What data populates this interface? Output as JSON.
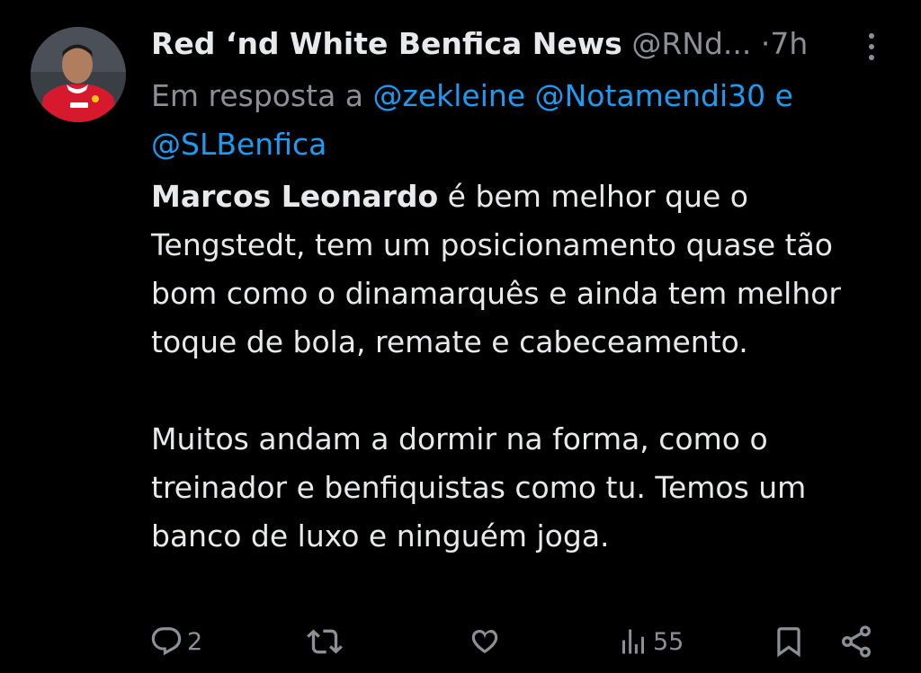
{
  "tweet": {
    "display_name": "Red ‘nd White Benfica News",
    "handle": "@RNd...",
    "separator": "·",
    "time": "7h",
    "reply_prefix": "Em resposta a",
    "mentions": [
      "@zekleine",
      "@Notamendi30",
      "@SLBenfica"
    ],
    "mention_joiner": "e",
    "body_bold": "Marcos Leonardo",
    "body_p1_rest": " é bem melhor que o Tengstedt, tem um posicionamento quase tão bom como o dinamarquês e ainda tem melhor toque de bola, remate e cabeceamento.",
    "body_p2": "Muitos andam a dormir na forma, como o treinador e benfiquistas como tu. Temos um banco de luxo e ninguém joga."
  },
  "actions": {
    "reply_count": "2",
    "retweet_count": "",
    "like_count": "",
    "views_count": "55"
  },
  "icons": {
    "more": "more-vertical-icon",
    "reply": "reply-icon",
    "retweet": "retweet-icon",
    "like": "heart-icon",
    "views": "views-icon",
    "bookmark": "bookmark-icon",
    "share": "share-icon"
  },
  "colors": {
    "background": "#000000",
    "text": "#e7e9ea",
    "muted": "#8b9096",
    "link": "#1d9bf0",
    "avatar_shirt": "#d7192d"
  }
}
